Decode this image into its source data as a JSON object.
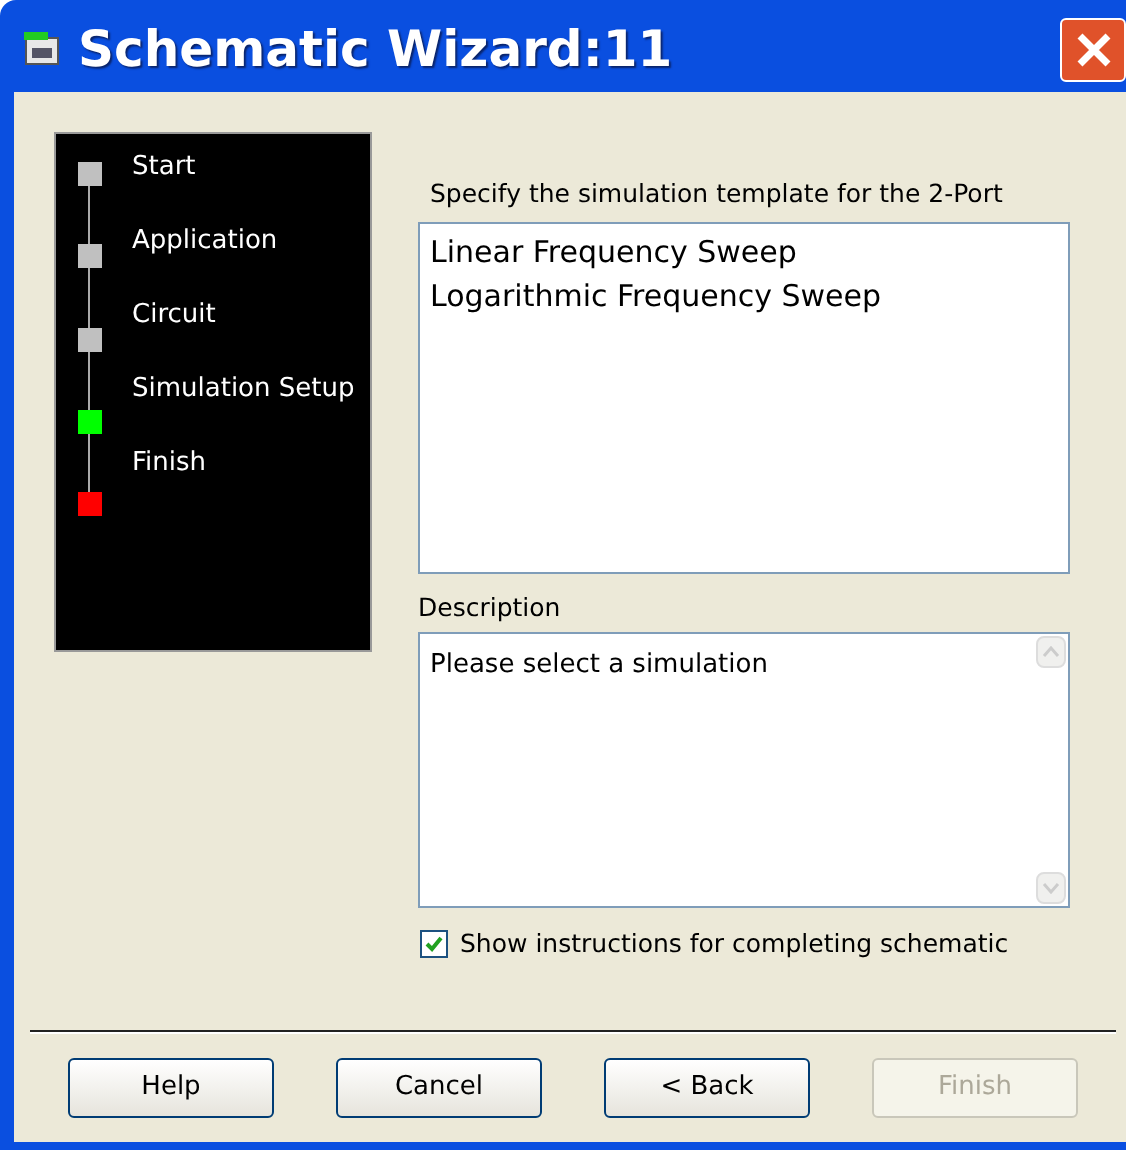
{
  "window": {
    "title": "Schematic Wizard:11"
  },
  "steps": [
    {
      "label": "Start",
      "color": "#c0c0c0"
    },
    {
      "label": "Application",
      "color": "#c0c0c0"
    },
    {
      "label": "Circuit",
      "color": "#c0c0c0"
    },
    {
      "label": "Simulation Setup",
      "color": "#00ff00"
    },
    {
      "label": "Finish",
      "color": "#ff0000"
    }
  ],
  "template": {
    "label": "Specify the simulation template for the 2-Port",
    "items": [
      {
        "label": "Linear Frequency Sweep",
        "selected": false
      },
      {
        "label": "Logarithmic Frequency Sweep",
        "selected": false
      }
    ]
  },
  "description": {
    "label": "Description",
    "value": "Please select a simulation"
  },
  "show_instructions": {
    "label": "Show instructions for completing schematic",
    "checked": true
  },
  "buttons": [
    {
      "label": "Help",
      "disabled": false
    },
    {
      "label": "Cancel",
      "disabled": false
    },
    {
      "label": "< Back",
      "disabled": false
    },
    {
      "label": "Finish",
      "disabled": true
    }
  ]
}
